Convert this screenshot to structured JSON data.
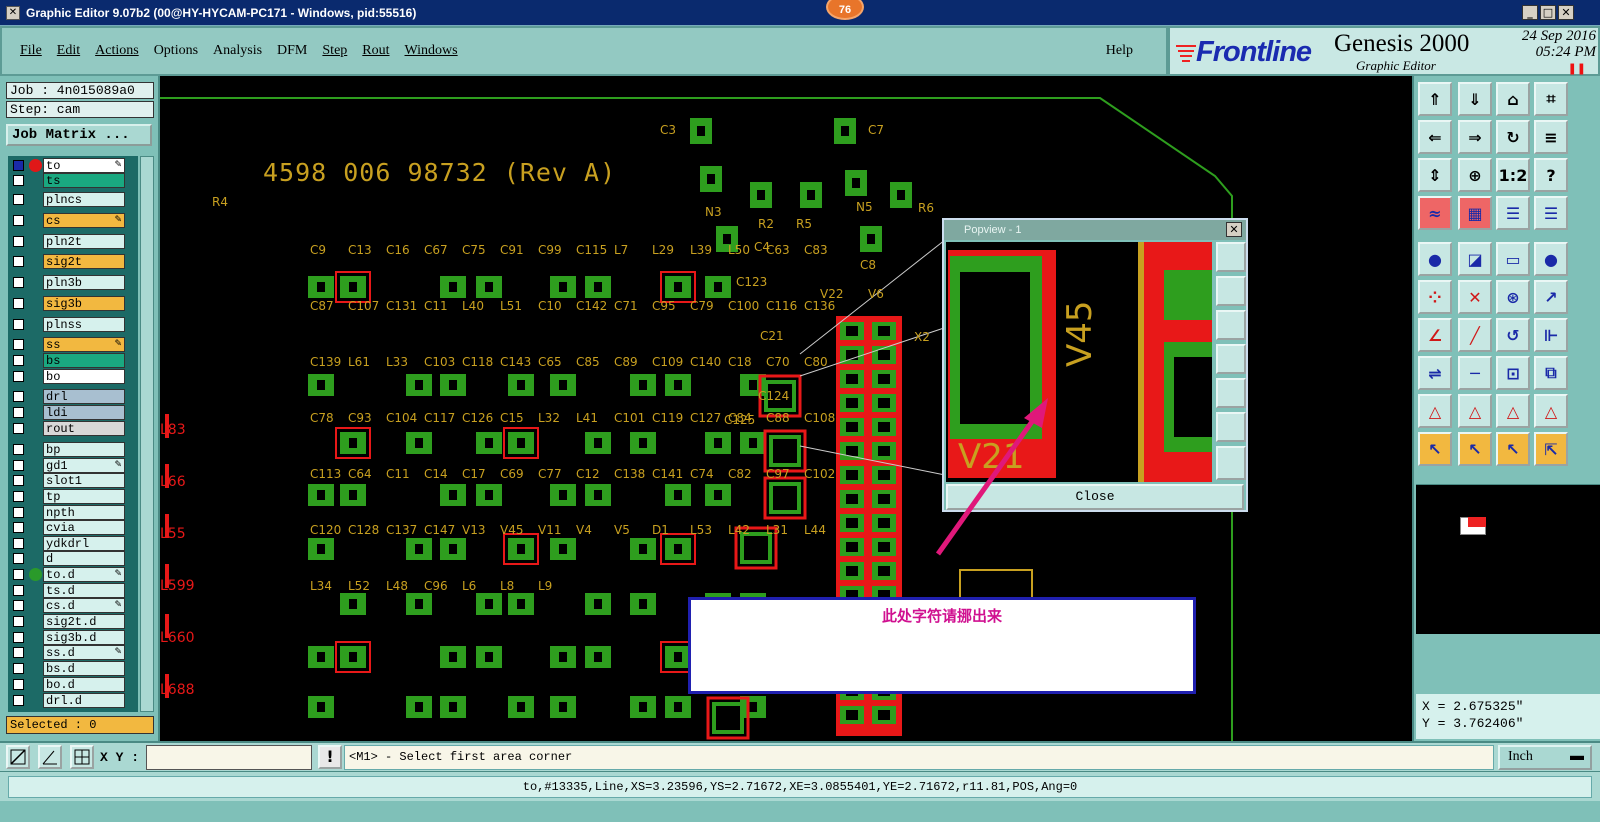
{
  "window": {
    "title": "Graphic Editor 9.07b2 (00@HY-HYCAM-PC171 - Windows, pid:55516)",
    "badge": "76",
    "sys_icon": "close-x-icon",
    "controls": [
      "minimize-icon",
      "maximize-icon",
      "close-icon"
    ]
  },
  "menu": {
    "items": [
      "File",
      "Edit",
      "Actions",
      "Options",
      "Analysis",
      "DFM",
      "Step",
      "Rout",
      "Windows"
    ],
    "help": "Help"
  },
  "brand": {
    "logo": "Frontline",
    "product": "Genesis 2000",
    "subtitle": "Graphic Editor",
    "date": "24 Sep 2016",
    "time": "05:24 PM"
  },
  "job": {
    "job_label": "Job : 4n015089a0",
    "step_label": "Step: cam",
    "matrix_button": "Job Matrix ..."
  },
  "layers": [
    {
      "name": "to",
      "bg": "#ffffff",
      "checked": true,
      "dot": "#e01818",
      "edit": true
    },
    {
      "name": "ts",
      "bg": "#1aa880",
      "checked": false,
      "dot": "",
      "edit": false
    },
    {
      "name": "plncs",
      "bg": "#d6f1ed",
      "checked": false,
      "dot": "",
      "edit": false
    },
    {
      "name": "cs",
      "bg": "#f2b840",
      "checked": false,
      "dot": "",
      "edit": true
    },
    {
      "name": "pln2t",
      "bg": "#d6f1ed",
      "checked": false,
      "dot": "",
      "edit": false
    },
    {
      "name": "sig2t",
      "bg": "#f2b840",
      "checked": false,
      "dot": "",
      "edit": false
    },
    {
      "name": "pln3b",
      "bg": "#d6f1ed",
      "checked": false,
      "dot": "",
      "edit": false
    },
    {
      "name": "sig3b",
      "bg": "#f2b840",
      "checked": false,
      "dot": "",
      "edit": false
    },
    {
      "name": "plnss",
      "bg": "#d6f1ed",
      "checked": false,
      "dot": "",
      "edit": false
    },
    {
      "name": "ss",
      "bg": "#f2b840",
      "checked": false,
      "dot": "",
      "edit": true
    },
    {
      "name": "bs",
      "bg": "#1aa880",
      "checked": false,
      "dot": "",
      "edit": false
    },
    {
      "name": "bo",
      "bg": "#ffffff",
      "checked": false,
      "dot": "",
      "edit": false
    },
    {
      "name": "drl",
      "bg": "#a8bfd0",
      "checked": false,
      "dot": "",
      "edit": false
    },
    {
      "name": "ldi",
      "bg": "#a8bfd0",
      "checked": false,
      "dot": "",
      "edit": false
    },
    {
      "name": "rout",
      "bg": "#d8d8d8",
      "checked": false,
      "dot": "",
      "edit": false
    },
    {
      "name": "bp",
      "bg": "#d6f1ed",
      "checked": false,
      "dot": "",
      "edit": false
    },
    {
      "name": "gd1",
      "bg": "#d6f1ed",
      "checked": false,
      "dot": "",
      "edit": true
    },
    {
      "name": "slot1",
      "bg": "#d6f1ed",
      "checked": false,
      "dot": "",
      "edit": false
    },
    {
      "name": "tp",
      "bg": "#d6f1ed",
      "checked": false,
      "dot": "",
      "edit": false
    },
    {
      "name": "npth",
      "bg": "#d6f1ed",
      "checked": false,
      "dot": "",
      "edit": false
    },
    {
      "name": "cvia",
      "bg": "#d6f1ed",
      "checked": false,
      "dot": "",
      "edit": false
    },
    {
      "name": "ydkdrl",
      "bg": "#d6f1ed",
      "checked": false,
      "dot": "",
      "edit": false
    },
    {
      "name": "d",
      "bg": "#d6f1ed",
      "checked": false,
      "dot": "",
      "edit": false
    },
    {
      "name": "to.d",
      "bg": "#d6f1ed",
      "checked": false,
      "dot": "#2a9a2a",
      "edit": true
    },
    {
      "name": "ts.d",
      "bg": "#d6f1ed",
      "checked": false,
      "dot": "",
      "edit": false
    },
    {
      "name": "cs.d",
      "bg": "#d6f1ed",
      "checked": false,
      "dot": "",
      "edit": true
    },
    {
      "name": "sig2t.d",
      "bg": "#d6f1ed",
      "checked": false,
      "dot": "",
      "edit": false
    },
    {
      "name": "sig3b.d",
      "bg": "#d6f1ed",
      "checked": false,
      "dot": "",
      "edit": false
    },
    {
      "name": "ss.d",
      "bg": "#d6f1ed",
      "checked": false,
      "dot": "",
      "edit": true
    },
    {
      "name": "bs.d",
      "bg": "#d6f1ed",
      "checked": false,
      "dot": "",
      "edit": false
    },
    {
      "name": "bo.d",
      "bg": "#d6f1ed",
      "checked": false,
      "dot": "",
      "edit": false
    },
    {
      "name": "drl.d",
      "bg": "#d6f1ed",
      "checked": false,
      "dot": "",
      "edit": false
    }
  ],
  "selected": "Selected : 0",
  "canvas": {
    "title": "4598 006 98732 (Rev A)",
    "refs_yellow": [
      "C3",
      "C7",
      "R4",
      "N3",
      "R2",
      "R5",
      "N5",
      "R6",
      "C4",
      "C8",
      "V22",
      "V6",
      "X2",
      "C123",
      "C21",
      "C124",
      "C125",
      "C9",
      "C13",
      "C16",
      "C67",
      "C75",
      "C91",
      "C99",
      "C115",
      "L7",
      "L29",
      "L39",
      "L50",
      "C63",
      "C83",
      "C87",
      "C107",
      "C131",
      "C11",
      "L40",
      "L51",
      "C10",
      "C142",
      "C71",
      "C95",
      "C79",
      "C100",
      "C116",
      "C136",
      "C139",
      "L61",
      "L33",
      "C103",
      "C118",
      "C143",
      "C65",
      "C85",
      "C89",
      "C109",
      "C140",
      "C18",
      "C70",
      "C80",
      "C78",
      "C93",
      "C104",
      "C117",
      "C126",
      "C15",
      "L32",
      "L41",
      "C101",
      "C119",
      "C127",
      "C84",
      "C88",
      "C108",
      "C113",
      "C64",
      "C11",
      "C14",
      "C17",
      "C69",
      "C77",
      "C12",
      "C138",
      "C141",
      "C74",
      "C82",
      "C97",
      "C102",
      "C120",
      "C128",
      "C137",
      "C147",
      "V13",
      "V45",
      "V11",
      "V4",
      "V5",
      "D1",
      "L53",
      "L42",
      "L31",
      "L44",
      "L34",
      "L52",
      "L48",
      "C96",
      "L6",
      "L8",
      "L9"
    ],
    "refs_red": [
      "L83",
      "L66",
      "L55",
      "L599",
      "L660",
      "L688"
    ]
  },
  "popview": {
    "title": "Popview - 1",
    "close_label": "Close",
    "label_v45": "V45",
    "label_v21": "V21"
  },
  "annotation": {
    "text": "此处字符请挪出来",
    "arrow_color": "#e0187a"
  },
  "coords": {
    "x": "X = 2.675325\"",
    "y": "Y = 3.762406\""
  },
  "bottom": {
    "xy_label": "X Y :",
    "xy_input_value": "",
    "alert_icon": "exclamation-icon",
    "prompt": "<M1> - Select first area corner",
    "units": "Inch"
  },
  "status": {
    "text": "to,#13335,Line,XS=3.23596,YS=2.71672,XE=3.0855401,YE=2.71672,r11.81,POS,Ang=0"
  },
  "toolbar_icons": [
    "home-top-icon",
    "home-bottom-icon",
    "home-icon",
    "frame-icon",
    "pan-left-icon",
    "pan-right-icon",
    "zoom-reset-icon",
    "redraw-icon",
    "zoom-fit-icon",
    "zoom-home-icon",
    "zoom-1-2-icon",
    "help-icon",
    "measure-icon",
    "grid-icon",
    "layer-red-icon",
    "layer-blue-icon",
    "snap-icon",
    "zoom-window-icon",
    "ruler-icon",
    "pad-icon",
    "connect-icon",
    "delete-icon",
    "add-pad-icon",
    "add-arc-icon",
    "line-add-icon",
    "line-cut-icon",
    "rotate-icon",
    "mirror-icon",
    "move-icon",
    "dash-icon",
    "measure-h-icon",
    "copy-icon",
    "triangle-a-icon",
    "triangle-b-icon",
    "triangle-c-icon",
    "triangle-d-icon",
    "select-icon",
    "select-box-icon",
    "select-all-icon",
    "select-net-icon"
  ]
}
